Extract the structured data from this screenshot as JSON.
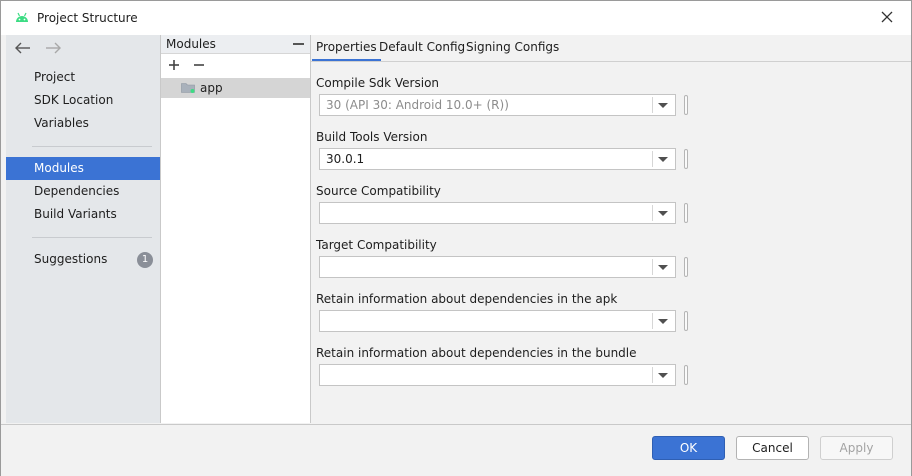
{
  "window": {
    "title": "Project Structure",
    "accent": "#3b73d4"
  },
  "sidebar": {
    "items": [
      {
        "label": "Project"
      },
      {
        "label": "SDK Location"
      },
      {
        "label": "Variables"
      },
      {
        "label": "Modules"
      },
      {
        "label": "Dependencies"
      },
      {
        "label": "Build Variants"
      },
      {
        "label": "Suggestions",
        "badge": "1"
      }
    ]
  },
  "modules": {
    "header": "Modules",
    "items": [
      {
        "label": "app"
      }
    ]
  },
  "tabs": [
    {
      "label": "Properties"
    },
    {
      "label": "Default Config"
    },
    {
      "label": "Signing Configs"
    }
  ],
  "fields": [
    {
      "label": "Compile Sdk Version",
      "value": "30",
      "hint": " (API 30: Android 10.0+ (R))"
    },
    {
      "label": "Build Tools Version",
      "value": "30.0.1"
    },
    {
      "label": "Source Compatibility",
      "value": ""
    },
    {
      "label": "Target Compatibility",
      "value": ""
    },
    {
      "label": "Retain information about dependencies in the apk",
      "value": ""
    },
    {
      "label": "Retain information about dependencies in the bundle",
      "value": ""
    }
  ],
  "footer": {
    "ok": "OK",
    "cancel": "Cancel",
    "apply": "Apply"
  }
}
